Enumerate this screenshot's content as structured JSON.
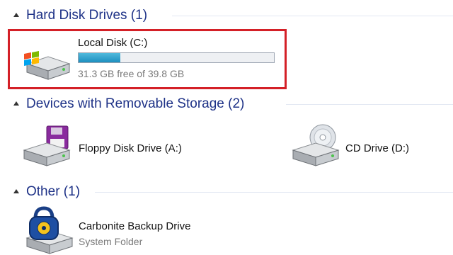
{
  "groups": [
    {
      "title": "Hard Disk Drives (1)"
    },
    {
      "title": "Devices with Removable Storage (2)"
    },
    {
      "title": "Other (1)"
    }
  ],
  "local_disk": {
    "name": "Local Disk (C:)",
    "free_text": "31.3 GB free of 39.8 GB",
    "used_fraction": 0.214,
    "icon": "windows-drive-icon"
  },
  "removable": [
    {
      "name": "Floppy Disk Drive (A:)",
      "icon": "floppy-drive-icon"
    },
    {
      "name": "CD Drive (D:)",
      "icon": "cd-drive-icon"
    }
  ],
  "other": [
    {
      "name": "Carbonite Backup Drive",
      "subtitle": "System Folder",
      "icon": "lock-drive-icon"
    }
  ],
  "colors": {
    "group_title": "#1e3287",
    "selection_outline": "#d42027",
    "bar_fill": "#1d8fbf"
  }
}
